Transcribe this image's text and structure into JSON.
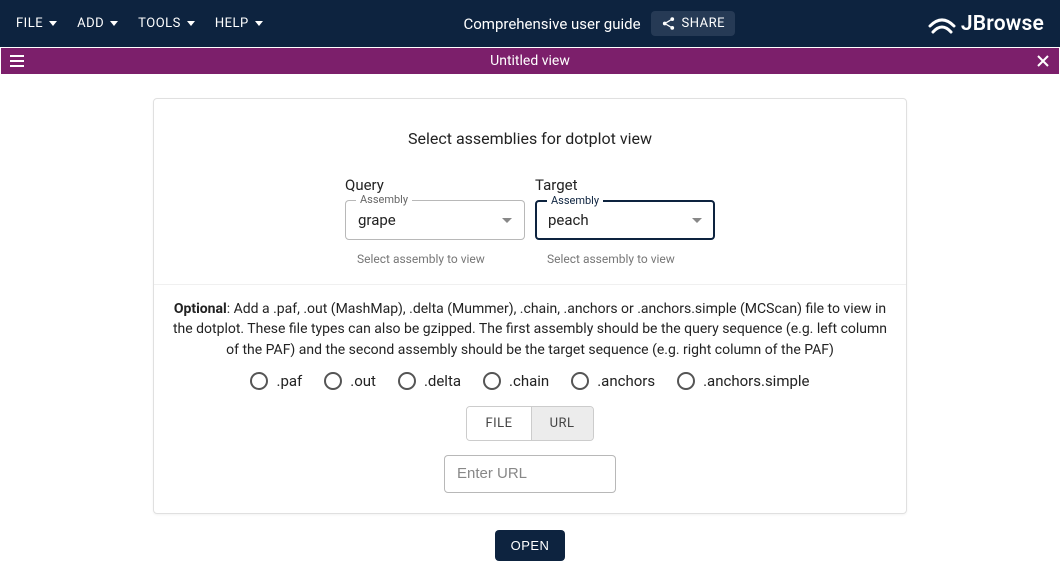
{
  "appbar": {
    "menus": [
      "FILE",
      "ADD",
      "TOOLS",
      "HELP"
    ],
    "guide": "Comprehensive user guide",
    "share": "SHARE",
    "logo": "JBrowse"
  },
  "viewbar": {
    "title": "Untitled view"
  },
  "card": {
    "title": "Select assemblies for dotplot view",
    "query": {
      "label": "Query",
      "floating": "Assembly",
      "value": "grape",
      "helper": "Select assembly to view"
    },
    "target": {
      "label": "Target",
      "floating": "Assembly",
      "value": "peach",
      "helper": "Select assembly to view"
    },
    "optional_strong": "Optional",
    "optional_text": ": Add a .paf, .out (MashMap), .delta (Mummer), .chain, .anchors or .anchors.simple (MCScan) file to view in the dotplot. These file types can also be gzipped. The first assembly should be the query sequence (e.g. left column of the PAF) and the second assembly should be the target sequence (e.g. right column of the PAF)",
    "radios": [
      ".paf",
      ".out",
      ".delta",
      ".chain",
      ".anchors",
      ".anchors.simple"
    ],
    "toggle": {
      "file": "FILE",
      "url": "URL"
    },
    "url_placeholder": "Enter URL",
    "open": "OPEN"
  }
}
